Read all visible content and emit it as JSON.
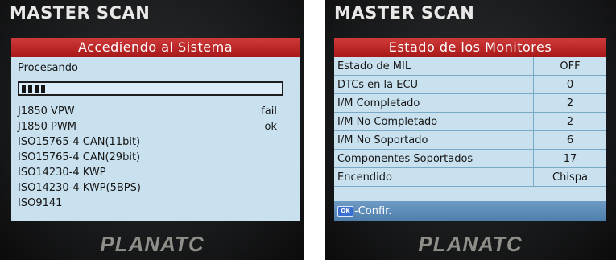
{
  "left_device": {
    "brand": "MASTER SCAN",
    "footer_brand": "PLANATC",
    "screen": {
      "title": "Accediendo al Sistema",
      "status_label": "Procesando",
      "progress": 0.1,
      "protocols": [
        {
          "name": "J1850 VPW",
          "status": "fail"
        },
        {
          "name": "J1850 PWM",
          "status": "ok"
        },
        {
          "name": "ISO15765-4 CAN(11bit)",
          "status": ""
        },
        {
          "name": "ISO15765-4 CAN(29bit)",
          "status": ""
        },
        {
          "name": "ISO14230-4 KWP",
          "status": ""
        },
        {
          "name": "ISO14230-4 KWP(5BPS)",
          "status": ""
        },
        {
          "name": "ISO9141",
          "status": ""
        }
      ]
    }
  },
  "right_device": {
    "brand": "MASTER SCAN",
    "footer_brand": "PLANATC",
    "screen": {
      "title": "Estado de los Monitores",
      "rows": [
        {
          "label": "Estado de MIL",
          "value": "OFF"
        },
        {
          "label": "DTCs en la ECU",
          "value": "0"
        },
        {
          "label": "I/M Completado",
          "value": "2"
        },
        {
          "label": "I/M No Completado",
          "value": "2"
        },
        {
          "label": "I/M No Soportado",
          "value": "6"
        },
        {
          "label": "Componentes Soportados",
          "value": "17"
        },
        {
          "label": "Encendido",
          "value": "Chispa"
        }
      ],
      "ok_key_label": "OK",
      "confirm_label": "-Confir."
    }
  },
  "colors": {
    "screen_bg": "#c9e1ef",
    "title_bar": "#b82222",
    "confirm_bar": "#5e8dba"
  }
}
